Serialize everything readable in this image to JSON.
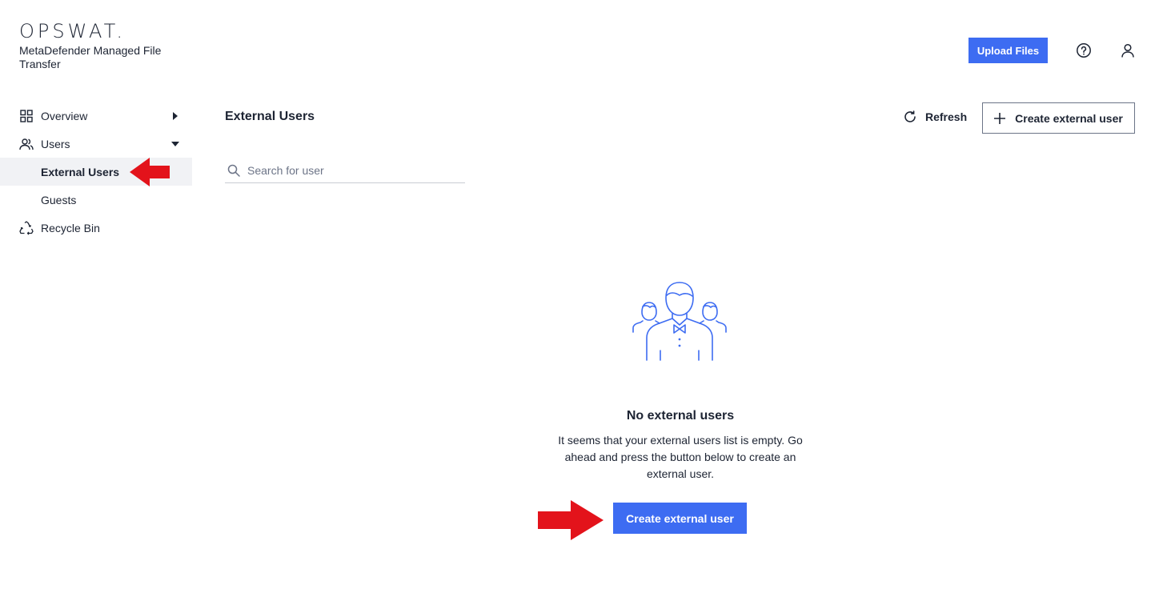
{
  "brand": {
    "logo_text": "OPSWAT.",
    "app_name": "MetaDefender Managed File Transfer"
  },
  "topbar": {
    "upload_label": "Upload Files",
    "help_icon": "question-circle-icon",
    "user_icon": "user-icon"
  },
  "sidebar": {
    "items": [
      {
        "label": "Overview",
        "icon": "grid-icon",
        "caret": "right"
      },
      {
        "label": "Users",
        "icon": "users-icon",
        "caret": "down"
      },
      {
        "label": "External Users",
        "active": true
      },
      {
        "label": "Guests"
      },
      {
        "label": "Recycle Bin",
        "icon": "recycle-icon"
      }
    ]
  },
  "main": {
    "title": "External Users",
    "refresh_label": "Refresh",
    "create_label": "Create external user",
    "search_placeholder": "Search for user",
    "empty": {
      "title": "No external users",
      "description": "It seems that your external users list is empty. Go ahead and press the button below to create an external user.",
      "button_label": "Create external user"
    }
  },
  "colors": {
    "accent": "#3d6cf2",
    "text": "#1d2433",
    "active_bg": "#f1f2f5",
    "annotation": "#e3131b"
  }
}
